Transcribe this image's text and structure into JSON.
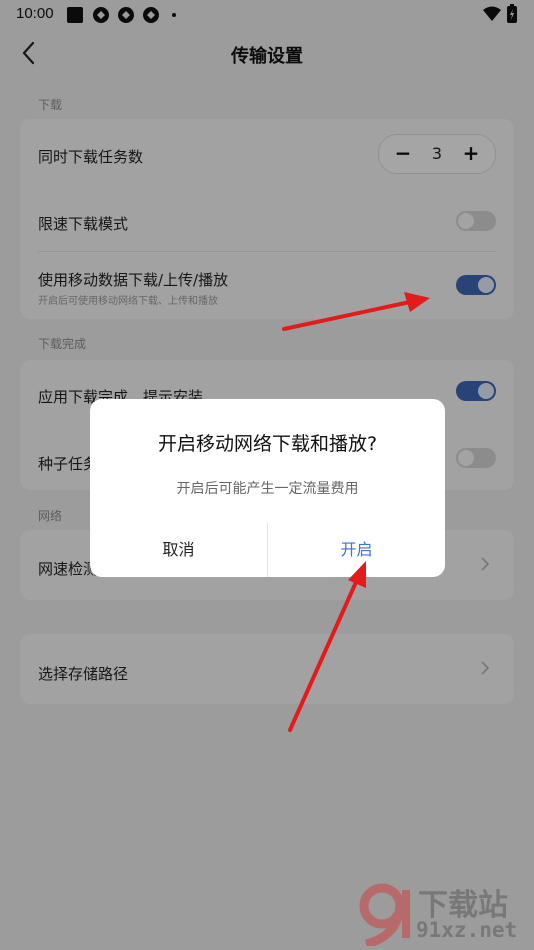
{
  "status_bar": {
    "time": "10:00"
  },
  "header": {
    "title": "传输设置"
  },
  "sections": {
    "download": {
      "label": "下载"
    },
    "complete": {
      "label": "下载完成"
    },
    "network": {
      "label": "网络"
    }
  },
  "rows": {
    "concurrent": {
      "label": "同时下载任务数",
      "value": "3",
      "minus": "−",
      "plus": "+"
    },
    "speed_limit": {
      "label": "限速下载模式",
      "on": false
    },
    "mobile_data": {
      "label": "使用移动数据下载/上传/播放",
      "sub": "开启后可使用移动网络下载、上传和播放",
      "on": true
    },
    "install_prompt": {
      "label": "应用下载完成，提示安装",
      "on": true
    },
    "seed_task": {
      "label": "种子任务",
      "on": false
    },
    "speed_test": {
      "label": "网速检测"
    },
    "storage_path": {
      "label": "选择存储路径"
    }
  },
  "dialog": {
    "title": "开启移动网络下载和播放?",
    "message": "开启后可能产生一定流量费用",
    "cancel": "取消",
    "confirm": "开启"
  },
  "watermark": {
    "brand": "下载站",
    "site": "91xz.net"
  },
  "colors": {
    "accent": "#3a63b0",
    "confirm": "#3b73d6",
    "arrow": "#e21b1b"
  }
}
